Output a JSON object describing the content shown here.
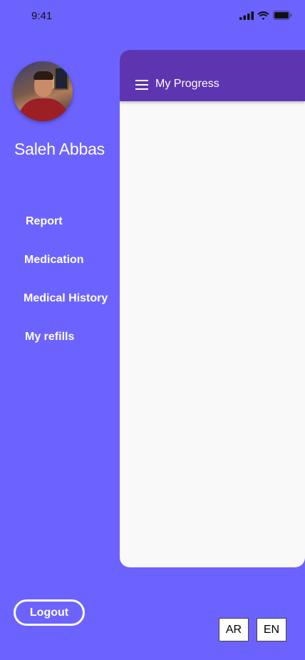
{
  "status_bar": {
    "time": "9:41",
    "icons": [
      "signal-icon",
      "wifi-icon",
      "battery-icon"
    ]
  },
  "profile": {
    "name": "Saleh Abbas",
    "avatar": "avatar-photo"
  },
  "menu": {
    "items": [
      {
        "label": "Report"
      },
      {
        "label": "Medication"
      },
      {
        "label": "Medical History"
      },
      {
        "label": "My refills"
      }
    ]
  },
  "header": {
    "title": "My Progress",
    "menu_icon": "hamburger-icon"
  },
  "footer": {
    "logout_label": "Logout",
    "languages": [
      "AR",
      "EN"
    ]
  },
  "colors": {
    "background": "#6C63FF",
    "header": "#5E35B1",
    "panel": "#F9F9F9"
  }
}
